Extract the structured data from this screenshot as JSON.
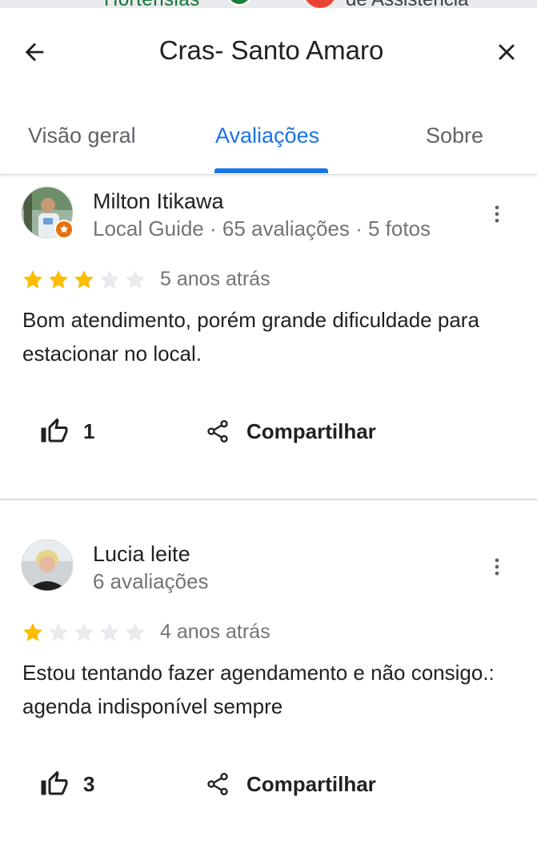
{
  "map": {
    "label_left": "Hortensias",
    "label_right": "de Assistência"
  },
  "header": {
    "title": "Cras- Santo Amaro",
    "back_icon": "arrow-back-icon",
    "close_icon": "close-icon"
  },
  "tabs": [
    {
      "label": "Visão geral",
      "active": false
    },
    {
      "label": "Avaliações",
      "active": true
    },
    {
      "label": "Sobre",
      "active": false
    }
  ],
  "colors": {
    "accent": "#1a73e8",
    "star_filled": "#fbbc04",
    "star_empty": "#e8eaed",
    "muted_text": "#70757a",
    "divider": "#dadce0"
  },
  "reviews": [
    {
      "author": "Milton Itikawa",
      "meta": "Local Guide · 65 avaliações · 5 fotos",
      "rating": 3,
      "max_rating": 5,
      "time": "5 anos atrás",
      "text": "Bom atendimento, porém grande dificuldade para estacionar no local.",
      "likes": "1",
      "share_label": "Compartilhar",
      "local_guide_badge": true
    },
    {
      "author": "Lucia leite",
      "meta": "6 avaliações",
      "rating": 1,
      "max_rating": 5,
      "time": "4 anos atrás",
      "text": "Estou tentando fazer agendamento e não consigo.: agenda indisponível  sempre",
      "likes": "3",
      "share_label": "Compartilhar",
      "local_guide_badge": false
    }
  ]
}
